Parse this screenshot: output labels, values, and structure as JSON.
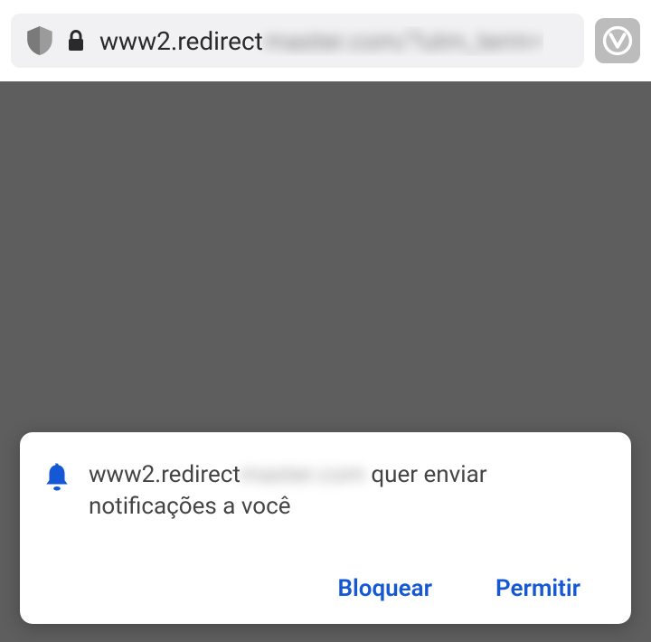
{
  "addressBar": {
    "urlVisible": "www2.redirect",
    "urlHidden": "master.com/?utm_term="
  },
  "dialog": {
    "domainVisible": "www2.redirect",
    "domainHidden": "master.com",
    "messageTail": " quer enviar notificações a você",
    "blockLabel": "Bloquear",
    "allowLabel": "Permitir"
  },
  "icons": {
    "shield": "shield-icon",
    "lock": "lock-icon",
    "browser": "vivaldi-icon",
    "bell": "bell-icon"
  },
  "colors": {
    "accent": "#1558d6",
    "pageBackground": "#5e5e5e",
    "addressBarBackground": "#f1f1f3"
  }
}
